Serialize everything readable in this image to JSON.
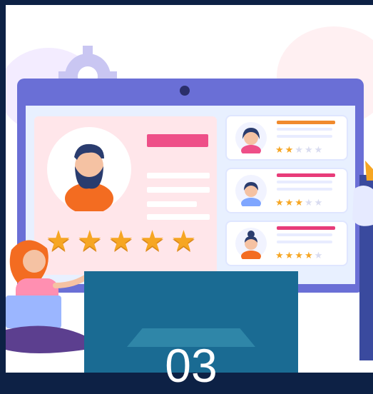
{
  "hero": {
    "overlay_number": "03",
    "main_rating": 5,
    "reviews": [
      {
        "rating": 2,
        "accent": "#f08a2d"
      },
      {
        "rating": 3,
        "accent": "#e83c79"
      },
      {
        "rating": 4,
        "accent": "#e83c79"
      }
    ]
  },
  "colors": {
    "background": "#0d2145",
    "monitor": "#6a6fd6",
    "screen": "#e8f0ff",
    "accent_pink": "#ee4f88",
    "star": "#f6a623",
    "overlay": "#1a6b93"
  },
  "icons": {
    "star": "★",
    "avatar_man": "avatar-bearded-man-icon",
    "gear": "gear-icon"
  }
}
